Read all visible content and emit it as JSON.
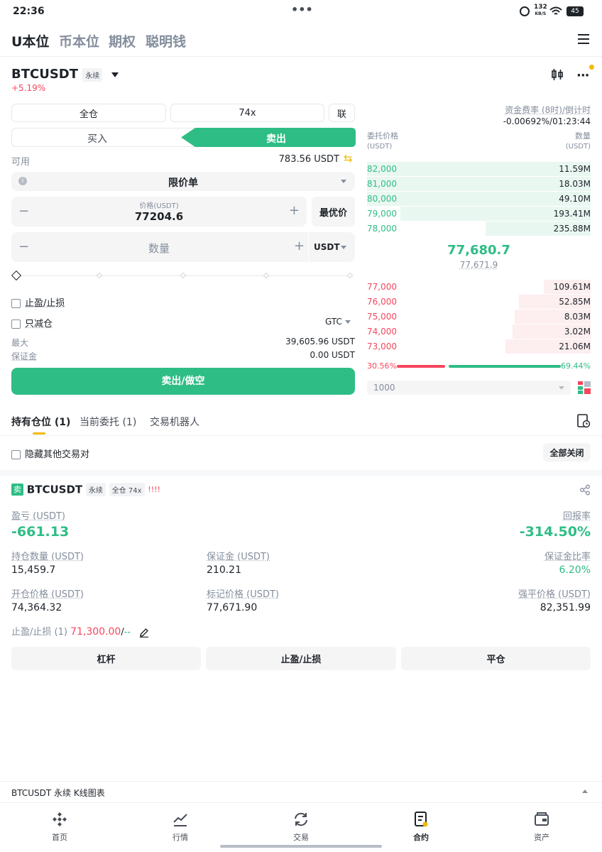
{
  "status": {
    "time": "22:36",
    "dots": "•••",
    "net": "132",
    "net_unit": "KB/S",
    "battery": "45"
  },
  "topnav": {
    "tabs": [
      "U本位",
      "币本位",
      "期权",
      "聪明钱"
    ],
    "active": 0
  },
  "symbol": {
    "name": "BTCUSDT",
    "badge": "永续",
    "change": "+5.19%"
  },
  "order": {
    "margin_mode": "全仓",
    "leverage": "74x",
    "lian": "联",
    "buy": "买入",
    "sell": "卖出",
    "available_label": "可用",
    "available_value": "783.56 USDT",
    "order_type": "限价单",
    "price_label": "价格(USDT)",
    "price_value": "77204.6",
    "best_price": "最优价",
    "qty_placeholder": "数量",
    "qty_unit": "USDT",
    "tp_sl": "止盈/止损",
    "reduce_only": "只减仓",
    "tif": "GTC",
    "max_label": "最大",
    "max_value": "39,605.96 USDT",
    "margin_label": "保证金",
    "margin_value": "0.00 USDT",
    "submit": "卖出/做空"
  },
  "orderbook": {
    "funding_label": "资金费率 (8时)/倒计时",
    "funding_value": "-0.00692%/01:23:44",
    "price_header": "委托价格",
    "price_unit": "(USDT)",
    "qty_header": "数量",
    "qty_unit": "(USDT)",
    "asks": [
      {
        "price": "82,000",
        "qty": "11.59M",
        "depth": 1.0
      },
      {
        "price": "81,000",
        "qty": "18.03M",
        "depth": 1.0
      },
      {
        "price": "80,000",
        "qty": "49.10M",
        "depth": 1.0
      },
      {
        "price": "79,000",
        "qty": "193.41M",
        "depth": 0.85
      },
      {
        "price": "78,000",
        "qty": "235.88M",
        "depth": 0.47
      }
    ],
    "last_price": "77,680.7",
    "mark_price": "77,671.9",
    "bids": [
      {
        "price": "77,000",
        "qty": "109.61M",
        "depth": 0.21
      },
      {
        "price": "76,000",
        "qty": "52.85M",
        "depth": 0.32
      },
      {
        "price": "75,000",
        "qty": "8.03M",
        "depth": 0.34
      },
      {
        "price": "74,000",
        "qty": "3.02M",
        "depth": 0.35
      },
      {
        "price": "73,000",
        "qty": "21.06M",
        "depth": 0.38
      }
    ],
    "sell_ratio": "30.56%",
    "buy_ratio": "69.44%",
    "sell_fraction": 0.3056,
    "depth_select": "1000"
  },
  "positions": {
    "tabs": [
      "持有仓位 (1)",
      "当前委托 (1)",
      "交易机器人"
    ],
    "hide_other": "隐藏其他交易对",
    "close_all": "全部关闭",
    "side": "卖",
    "symbol": "BTCUSDT",
    "badge": "永续",
    "mode": "全仓 74x",
    "risk": "!!!!",
    "pnl_label": "盈亏 (USDT)",
    "pnl_value": "-661.13",
    "roe_label": "回报率",
    "roe_value": "-314.50%",
    "size_label": "持仓数量 (USDT)",
    "size_value": "15,459.7",
    "margin_label": "保证金 (USDT)",
    "margin_value": "210.21",
    "ratio_label": "保证金比率",
    "ratio_value": "6.20%",
    "entry_label": "开仓价格 (USDT)",
    "entry_value": "74,364.32",
    "mark_label": "标记价格 (USDT)",
    "mark_value": "77,671.90",
    "liq_label": "强平价格 (USDT)",
    "liq_value": "82,351.99",
    "tpsl_label": "止盈/止损 (1)",
    "tpsl_tp": "71,300.00",
    "tpsl_sep": "/",
    "tpsl_sl": "--",
    "btn_leverage": "杠杆",
    "btn_tpsl": "止盈/止损",
    "btn_close": "平仓"
  },
  "chart_bar": {
    "label": "BTCUSDT 永续 K线图表"
  },
  "tabbar": {
    "items": [
      "首页",
      "行情",
      "交易",
      "合约",
      "资产"
    ],
    "active": 3
  },
  "colors": {
    "green": "#2ebd85",
    "red": "#f6465d",
    "accent": "#f0b90b"
  }
}
